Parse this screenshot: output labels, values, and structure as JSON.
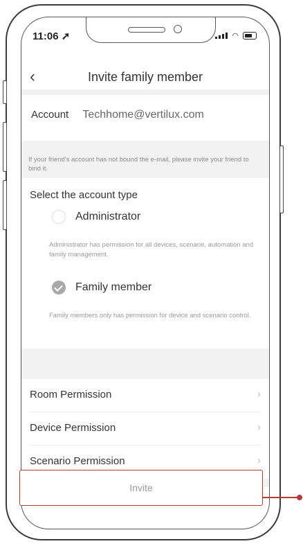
{
  "status_bar": {
    "time": "11:06"
  },
  "nav": {
    "back_icon": "chevron-left-icon",
    "title": "Invite family member"
  },
  "account": {
    "label": "Account",
    "value": "Techhome@vertilux.com"
  },
  "account_note": "If your friend's account has not bound the e-mail, please invite your friend to bind it.",
  "account_type": {
    "heading": "Select the account type",
    "options": [
      {
        "label": "Administrator",
        "selected": false,
        "description": "Administrator has permission for all devices, scenarie, automation and family management."
      },
      {
        "label": "Family member",
        "selected": true,
        "description": "Family members only has permission for device and scenario control."
      }
    ]
  },
  "permissions": [
    {
      "label": "Room Permission"
    },
    {
      "label": "Device Permission"
    },
    {
      "label": "Scenario Permission"
    }
  ],
  "invite_button": {
    "label": "Invite"
  },
  "colors": {
    "highlight": "#b53a3a",
    "selected_radio": "#a8a8a8",
    "band": "#f2f2f2"
  }
}
